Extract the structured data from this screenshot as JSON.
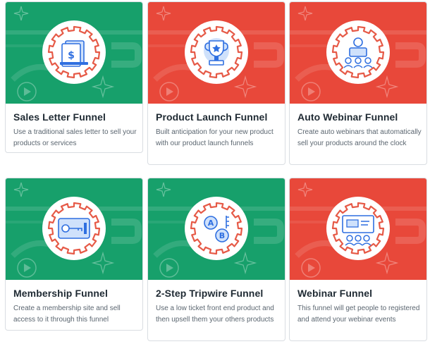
{
  "colors": {
    "green": "#17a06b",
    "red": "#e8483a",
    "icon_blue": "#2f6fe0",
    "icon_light": "#cfe1fb",
    "gear": "#e65a47"
  },
  "cards": [
    {
      "title": "Sales Letter Funnel",
      "description": "Use a traditional sales letter to sell your products or services",
      "theme": "green",
      "icon": "sales-letter-icon"
    },
    {
      "title": "Product Launch Funnel",
      "description": "Built anticipation for your new product with our product launch funnels",
      "theme": "red",
      "icon": "trophy-icon"
    },
    {
      "title": "Auto Webinar Funnel",
      "description": "Create auto webinars that automatically sell your products around the clock",
      "theme": "red",
      "icon": "presenter-icon"
    },
    {
      "title": "Membership Funnel",
      "description": "Create a membership site and sell access to it through this funnel",
      "theme": "green",
      "icon": "membership-key-icon"
    },
    {
      "title": "2-Step Tripwire Funnel",
      "description": "Use a low ticket front end product and then upsell them your others products",
      "theme": "green",
      "icon": "ab-split-icon"
    },
    {
      "title": "Webinar Funnel",
      "description": "This funnel will get people to registered and attend your webinar events",
      "theme": "red",
      "icon": "webinar-icon"
    }
  ]
}
